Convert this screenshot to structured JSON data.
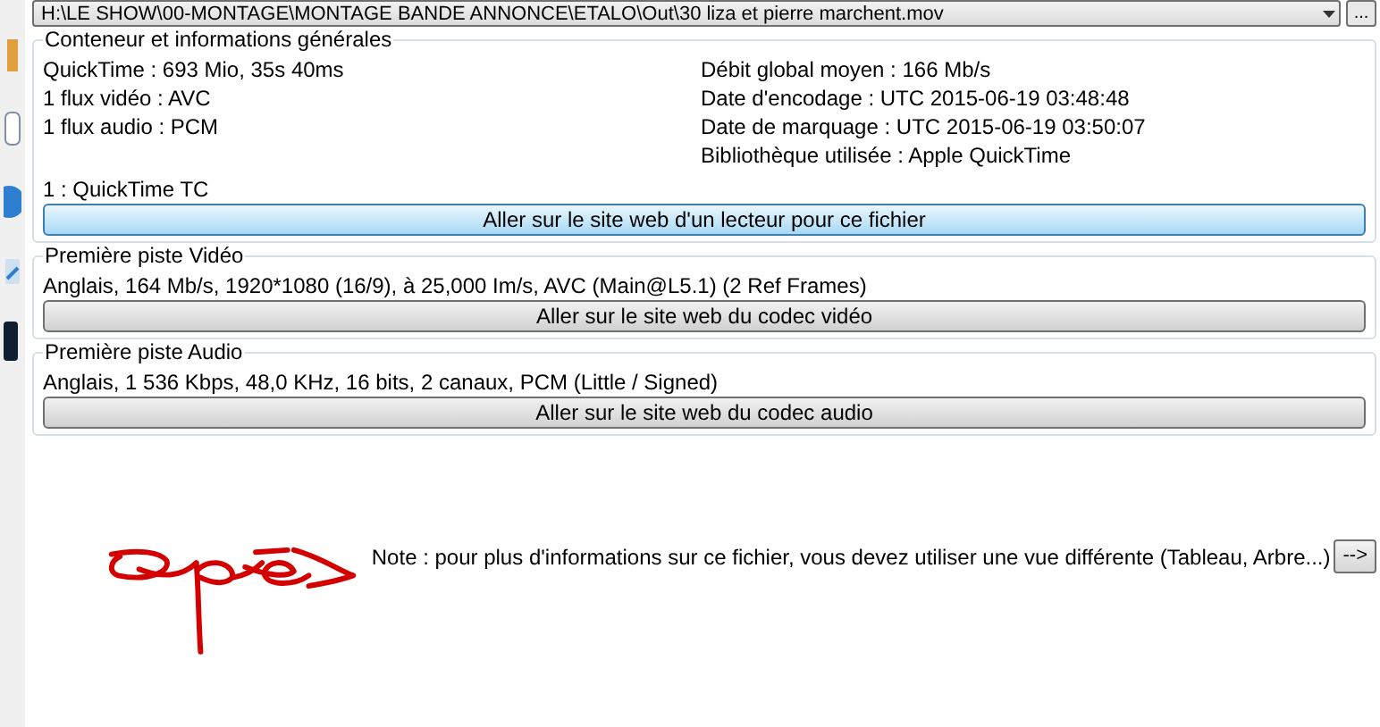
{
  "file_path": "H:\\LE SHOW\\00-MONTAGE\\MONTAGE BANDE ANNONCE\\ETALO\\Out\\30 liza et pierre marchent.mov",
  "browse_button": "...",
  "general": {
    "title": "Conteneur et informations générales",
    "left_lines": [
      "QuickTime : 693 Mio, 35s 40ms",
      "1 flux vidéo : AVC",
      "1 flux audio : PCM"
    ],
    "right_lines": [
      "Débit global moyen : 166 Mb/s",
      "Date d'encodage : UTC 2015-06-19 03:48:48",
      "Date de marquage : UTC 2015-06-19 03:50:07",
      "Bibliothèque utilisée : Apple QuickTime"
    ],
    "other_line": "1 : QuickTime TC",
    "button": "Aller sur le site web d'un lecteur pour ce fichier"
  },
  "tracks": [
    {
      "title": "Première piste Vidéo",
      "line": "Anglais, 164 Mb/s, 1920*1080 (16/9), à 25,000 Im/s, AVC (Main@L5.1) (2 Ref Frames)",
      "button": "Aller sur le site web du codec vidéo"
    },
    {
      "title": "Première piste Audio",
      "line": "Anglais, 1 536 Kbps, 48,0 KHz, 16 bits, 2 canaux, PCM (Little / Signed)",
      "button": "Aller sur le site web du codec audio"
    }
  ],
  "note": {
    "text": "Note : pour plus d'informations sur ce fichier, vous devez utiliser une vue différente (Tableau, Arbre...)",
    "button": "-->"
  }
}
